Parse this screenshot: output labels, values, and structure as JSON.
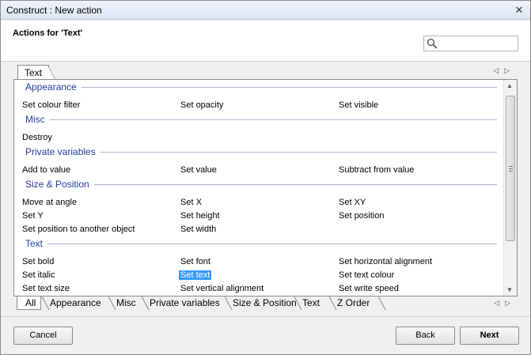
{
  "window": {
    "title": "Construct : New action",
    "close_glyph": "✕"
  },
  "header": {
    "heading": "Actions for 'Text'",
    "search": {
      "value": "",
      "placeholder": ""
    }
  },
  "top_tab": {
    "label": "Text"
  },
  "sections": [
    {
      "title": "Appearance",
      "items": [
        [
          "Set colour filter",
          "Set opacity",
          "Set visible"
        ]
      ]
    },
    {
      "title": "Misc",
      "items": [
        [
          "Destroy"
        ]
      ]
    },
    {
      "title": "Private variables",
      "items": [
        [
          "Add to value",
          "Set value",
          "Subtract from value"
        ]
      ]
    },
    {
      "title": "Size & Position",
      "items": [
        [
          "Move at angle",
          "Set X",
          "Set XY"
        ],
        [
          "Set Y",
          "Set height",
          "Set position"
        ],
        [
          "Set position to another object",
          "Set width"
        ]
      ]
    },
    {
      "title": "Text",
      "items": [
        [
          "Set bold",
          "Set font",
          "Set horizontal alignment"
        ],
        [
          "Set italic",
          "Set text",
          "Set text colour"
        ],
        [
          "Set text size",
          "Set vertical alignment",
          "Set write speed"
        ]
      ]
    }
  ],
  "selected_item": "Set text",
  "bottom_tabs": [
    "All",
    "Appearance",
    "Misc",
    "Private variables",
    "Size & Position",
    "Text",
    "Z Order"
  ],
  "active_bottom_tab": "All",
  "buttons": {
    "cancel": "Cancel",
    "back": "Back",
    "next": "Next"
  },
  "icons": {
    "search": "search-icon",
    "left_arrow": "◁",
    "right_arrow": "▷",
    "up_arrow": "▲",
    "down_arrow": "▼"
  },
  "colors": {
    "section_title": "#1f3f9c",
    "selection": "#3399ff"
  }
}
